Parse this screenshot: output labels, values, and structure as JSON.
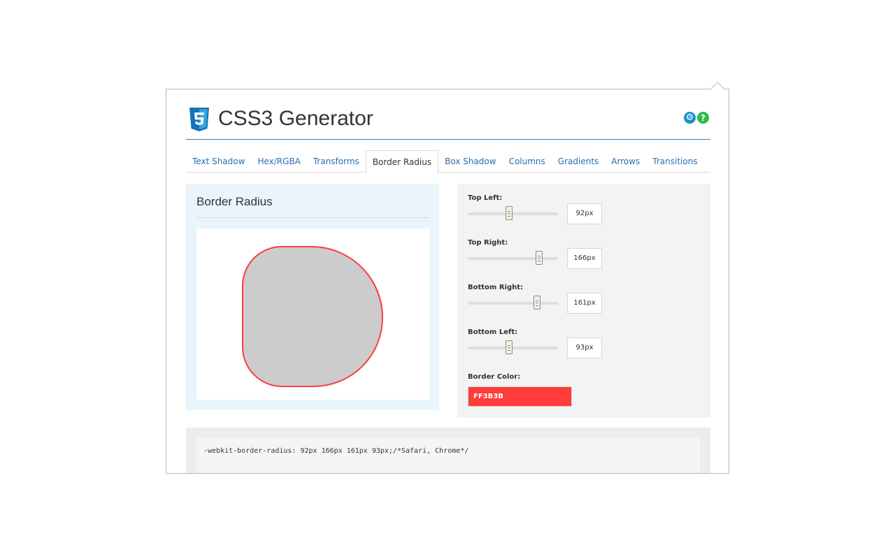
{
  "app": {
    "title": "CSS3 Generator",
    "logo_icon": "css3-shield-icon"
  },
  "header_icons": [
    {
      "name": "gear-icon",
      "glyph": "⚙",
      "color": "#1d8fc7"
    },
    {
      "name": "help-icon",
      "glyph": "?",
      "color": "#2dbb4a"
    }
  ],
  "tabs": [
    {
      "label": "Text Shadow",
      "active": false
    },
    {
      "label": "Hex/RGBA",
      "active": false
    },
    {
      "label": "Transforms",
      "active": false
    },
    {
      "label": "Border Radius",
      "active": true
    },
    {
      "label": "Box Shadow",
      "active": false
    },
    {
      "label": "Columns",
      "active": false
    },
    {
      "label": "Gradients",
      "active": false
    },
    {
      "label": "Arrows",
      "active": false
    },
    {
      "label": "Transitions",
      "active": false
    }
  ],
  "preview": {
    "title": "Border Radius",
    "fill_color": "#cccccc"
  },
  "controls": {
    "top_left": {
      "label": "Top Left:",
      "value": "92px",
      "slider_fraction": 0.46
    },
    "top_right": {
      "label": "Top Right:",
      "value": "166px",
      "slider_fraction": 0.79
    },
    "bottom_right": {
      "label": "Bottom Right:",
      "value": "161px",
      "slider_fraction": 0.77
    },
    "bottom_left": {
      "label": "Bottom Left:",
      "value": "93px",
      "slider_fraction": 0.46
    },
    "border_color": {
      "label": "Border Color:",
      "value": "FF3B3B",
      "color": "#ff3b3b"
    }
  },
  "code": {
    "line1": "-webkit-border-radius: 92px 166px 161px 93px;/*Safari, Chrome*/"
  }
}
